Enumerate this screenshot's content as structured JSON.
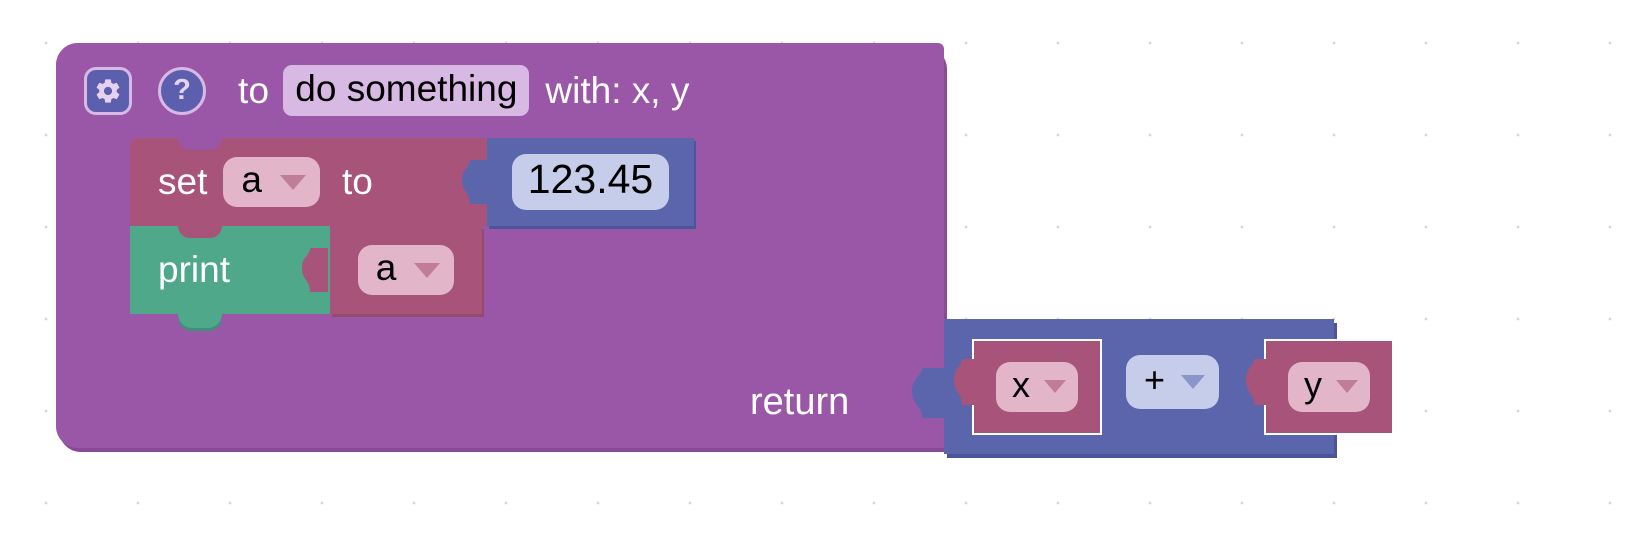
{
  "workspace": {
    "background_color": "#ffffff",
    "grid_dot_color": "#a0a0a5",
    "grid_spacing_px": 92
  },
  "colors": {
    "procedure_purple": "#9a57a8",
    "procedure_purple_shadow": "#8a4a97",
    "variable_magenta": "#a8547a",
    "variable_field": "#e2b6c8",
    "print_green": "#4fa88a",
    "math_blue": "#5b65ac",
    "math_field": "#c6cdea",
    "name_field_lilac": "#d8b9e4",
    "icon_button_blue": "#5b5fad",
    "selection_outline": "#ffffff",
    "text_white": "#ffffff",
    "text_black": "#000000"
  },
  "procedure_block": {
    "gear_icon": "gear-icon",
    "help_icon": "question-mark-icon",
    "to_label": "to",
    "name_value": "do something",
    "with_label": "with: x, y",
    "params": [
      "x",
      "y"
    ]
  },
  "statements": [
    {
      "kind": "set-variable",
      "set_label": "set",
      "variable_value": "a",
      "dropdown_icon": "chevron-down-icon",
      "to_label": "to",
      "value_block": {
        "kind": "number",
        "value": "123.45"
      }
    },
    {
      "kind": "print",
      "print_label": "print",
      "value_block": {
        "kind": "variable-get",
        "variable_value": "a",
        "dropdown_icon": "chevron-down-icon"
      }
    }
  ],
  "return_row": {
    "return_label": "return",
    "expression": {
      "kind": "arithmetic",
      "left": {
        "kind": "variable-get",
        "variable_value": "x",
        "dropdown_icon": "chevron-down-icon",
        "selected": true
      },
      "operator_value": "+",
      "operator_dropdown_icon": "chevron-down-icon",
      "right": {
        "kind": "variable-get",
        "variable_value": "y",
        "dropdown_icon": "chevron-down-icon",
        "selected": true
      }
    }
  }
}
